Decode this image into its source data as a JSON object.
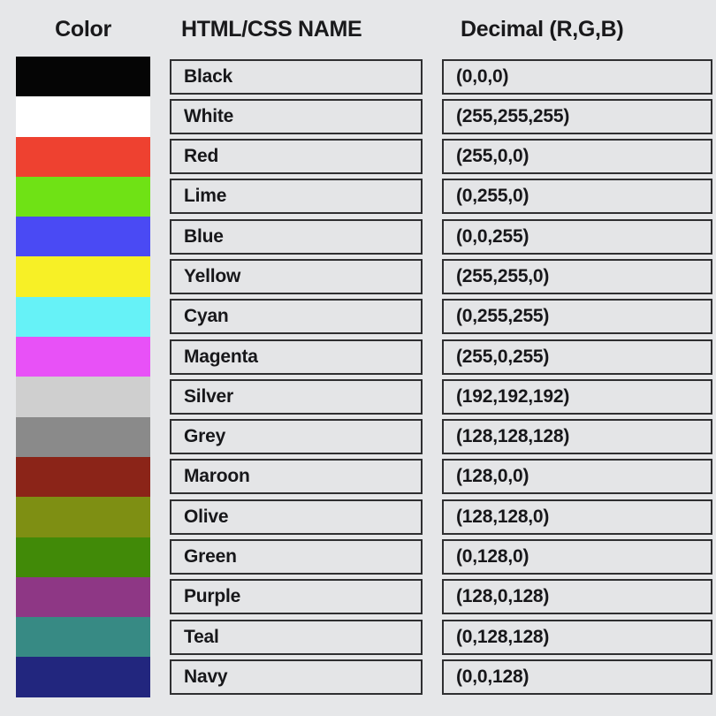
{
  "headers": {
    "swatch": "Color",
    "name": "HTML/CSS NAME",
    "decimal": "Decimal (R,G,B)"
  },
  "page": {
    "background_color": "#E6E7E9",
    "cell_fill_color": "#E4E5E7",
    "cell_border_color": "#2F2F31",
    "text_color": "#17171A"
  },
  "rows": [
    {
      "name": "Black",
      "decimal": "(0,0,0)",
      "swatch_color": "#050505"
    },
    {
      "name": "White",
      "decimal": "(255,255,255)",
      "swatch_color": "#FFFFFF"
    },
    {
      "name": "Red",
      "decimal": "(255,0,0)",
      "swatch_color": "#EE4130"
    },
    {
      "name": "Lime",
      "decimal": "(0,255,0)",
      "swatch_color": "#6FE215"
    },
    {
      "name": "Blue",
      "decimal": "(0,0,255)",
      "swatch_color": "#4A4AF4"
    },
    {
      "name": "Yellow",
      "decimal": "(255,255,0)",
      "swatch_color": "#F7F026"
    },
    {
      "name": "Cyan",
      "decimal": "(0,255,255)",
      "swatch_color": "#66F2F7"
    },
    {
      "name": "Magenta",
      "decimal": "(255,0,255)",
      "swatch_color": "#E851F7"
    },
    {
      "name": "Silver",
      "decimal": "(192,192,192)",
      "swatch_color": "#CFCFCF"
    },
    {
      "name": "Grey",
      "decimal": "(128,128,128)",
      "swatch_color": "#8A8A8A"
    },
    {
      "name": "Maroon",
      "decimal": "(128,0,0)",
      "swatch_color": "#8B2418"
    },
    {
      "name": "Olive",
      "decimal": "(128,128,0)",
      "swatch_color": "#7E8F13"
    },
    {
      "name": "Green",
      "decimal": "(0,128,0)",
      "swatch_color": "#418A08"
    },
    {
      "name": "Purple",
      "decimal": "(128,0,128)",
      "swatch_color": "#8E3785"
    },
    {
      "name": "Teal",
      "decimal": "(0,128,128)",
      "swatch_color": "#378A84"
    },
    {
      "name": "Navy",
      "decimal": "(0,0,128)",
      "swatch_color": "#22267E"
    }
  ]
}
